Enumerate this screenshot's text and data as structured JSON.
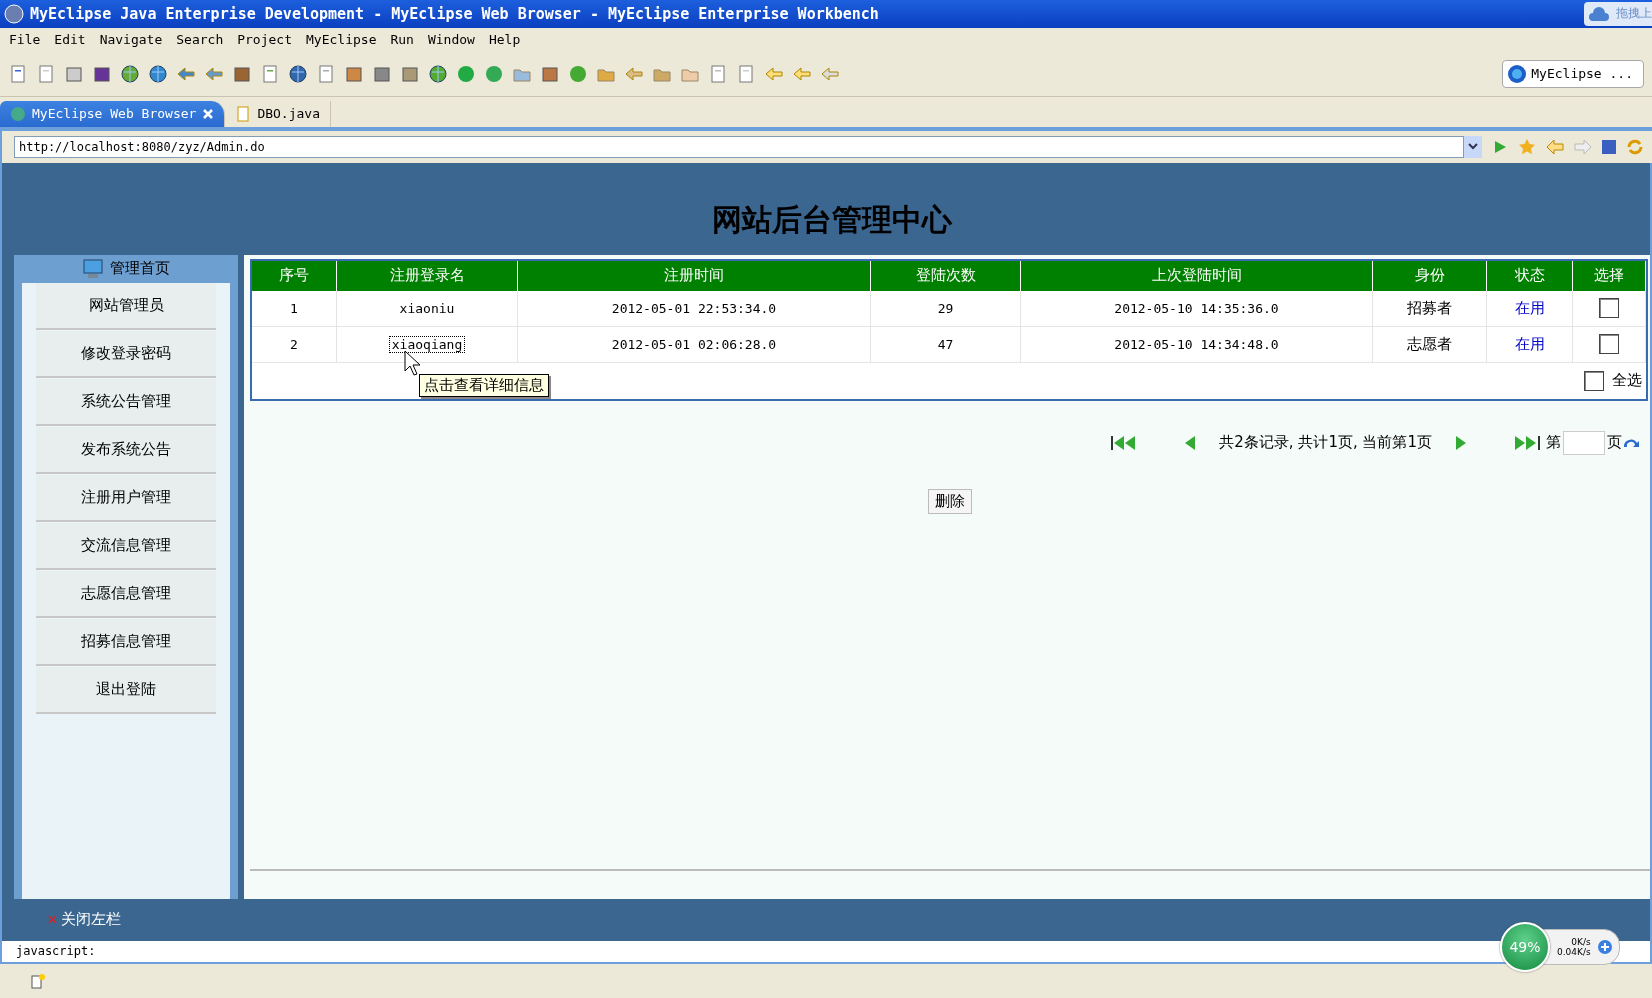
{
  "window": {
    "title": "MyEclipse Java Enterprise Development - MyEclipse Web Browser - MyEclipse Enterprise Workbench"
  },
  "drag_hint": "拖拽上",
  "menu": [
    "File",
    "Edit",
    "Navigate",
    "Search",
    "Project",
    "MyEclipse",
    "Run",
    "Window",
    "Help"
  ],
  "perspective": "MyEclipse ...",
  "editor_tabs": [
    {
      "label": "MyEclipse Web Browser",
      "selected": true
    },
    {
      "label": "DBO.java",
      "selected": false
    }
  ],
  "address_bar": {
    "url": "http://localhost:8080/zyz/Admin.do"
  },
  "page": {
    "title": "网站后台管理中心"
  },
  "sidebar": {
    "header": "管理首页",
    "items": [
      "网站管理员",
      "修改登录密码",
      "系统公告管理",
      "发布系统公告",
      "注册用户管理",
      "交流信息管理",
      "志愿信息管理",
      "招募信息管理",
      "退出登陆"
    ]
  },
  "table": {
    "columns": [
      "序号",
      "注册登录名",
      "注册时间",
      "登陆次数",
      "上次登陆时间",
      "身份",
      "状态",
      "选择"
    ],
    "rows": [
      {
        "cells": [
          "1",
          "xiaoniu",
          "2012-05-01 22:53:34.0",
          "29",
          "2012-05-10 14:35:36.0",
          "招募者"
        ],
        "status": "在用",
        "focused": false,
        "checked": false
      },
      {
        "cells": [
          "2",
          "xiaoqiang",
          "2012-05-01 02:06:28.0",
          "47",
          "2012-05-10 14:34:48.0",
          "志愿者"
        ],
        "status": "在用",
        "focused": true,
        "checked": false
      }
    ],
    "select_all": {
      "label": "全选",
      "checked": false
    }
  },
  "tooltip": "点击查看详细信息",
  "pagination": {
    "summary": "共2条记录, 共计1页, 当前第1页",
    "page_prefix": "第",
    "page_suffix": "页"
  },
  "delete_button": "删除",
  "close_sidebar": "关闭左栏",
  "status_text": "javascript:",
  "net_widget": {
    "percent": "49%",
    "upload": "0K/s",
    "download": "0.04K/s"
  }
}
